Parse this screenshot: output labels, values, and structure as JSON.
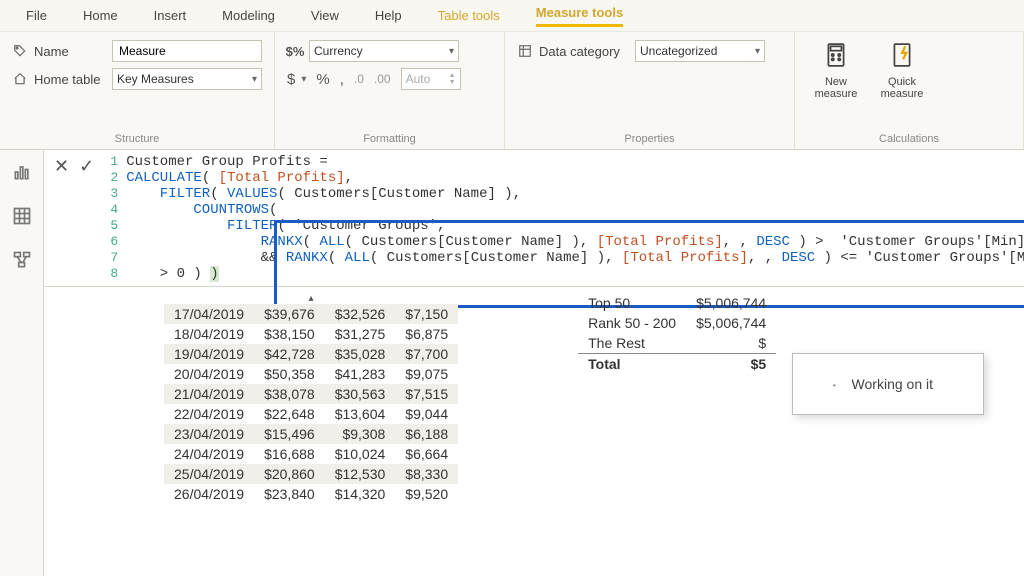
{
  "menubar": {
    "items": [
      "File",
      "Home",
      "Insert",
      "Modeling",
      "View",
      "Help",
      "Table tools",
      "Measure tools"
    ],
    "active": "Measure tools",
    "orange": [
      "Table tools",
      "Measure tools"
    ]
  },
  "ribbon": {
    "structure": {
      "label": "Structure",
      "name_label": "Name",
      "name_value": "Measure",
      "home_table_label": "Home table",
      "home_table_value": "Key Measures"
    },
    "formatting": {
      "label": "Formatting",
      "format_value": "Currency",
      "auto_value": "Auto",
      "dollar": "$",
      "percent": "%",
      "comma": ",",
      "dec_inc": ".0",
      "dec_dec": ".00"
    },
    "properties": {
      "label": "Properties",
      "data_category_label": "Data category",
      "data_category_value": "Uncategorized"
    },
    "calculations": {
      "label": "Calculations",
      "new_measure": "New measure",
      "quick_measure": "Quick measure"
    }
  },
  "formula": {
    "lines_plain": [
      "Customer Group Profits =",
      "CALCULATE( [Total Profits],",
      "    FILTER( VALUES( Customers[Customer Name] ),",
      "        COUNTROWS(",
      "            FILTER( 'Customer Groups',",
      "                RANKX( ALL( Customers[Customer Name] ), [Total Profits], , DESC ) >  'Customer Groups'[Min]",
      "                && RANKX( ALL( Customers[Customer Name] ), [Total Profits], , DESC ) <= 'Customer Groups'[Max] ) )",
      "    > 0 ) )"
    ]
  },
  "left_table": {
    "rows": [
      [
        "17/04/2019",
        "$39,676",
        "$32,526",
        "$7,150"
      ],
      [
        "18/04/2019",
        "$38,150",
        "$31,275",
        "$6,875"
      ],
      [
        "19/04/2019",
        "$42,728",
        "$35,028",
        "$7,700"
      ],
      [
        "20/04/2019",
        "$50,358",
        "$41,283",
        "$9,075"
      ],
      [
        "21/04/2019",
        "$38,078",
        "$30,563",
        "$7,515"
      ],
      [
        "22/04/2019",
        "$22,648",
        "$13,604",
        "$9,044"
      ],
      [
        "23/04/2019",
        "$15,496",
        "$9,308",
        "$6,188"
      ],
      [
        "24/04/2019",
        "$16,688",
        "$10,024",
        "$6,664"
      ],
      [
        "25/04/2019",
        "$20,860",
        "$12,530",
        "$8,330"
      ],
      [
        "26/04/2019",
        "$23,840",
        "$14,320",
        "$9,520"
      ]
    ]
  },
  "right_table": {
    "rows": [
      [
        "Top 50",
        "$5,006,744"
      ],
      [
        "Rank 50 - 200",
        "$5,006,744"
      ],
      [
        "The Rest",
        "$"
      ],
      [
        "Total",
        "$5"
      ]
    ]
  },
  "tooltip": "Working on it"
}
